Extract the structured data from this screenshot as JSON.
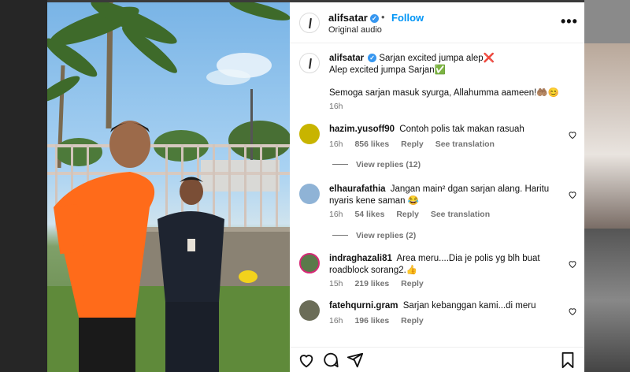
{
  "post": {
    "username": "alifsatar",
    "verified": true,
    "follow_label": "Follow",
    "audio_label": "Original audio",
    "more_label": "•••"
  },
  "caption": {
    "username": "alifsatar",
    "line1": "Sarjan excited jumpa alep❌",
    "line2": "Alep excited jumpa Sarjan✅",
    "line3": "Semoga sarjan masuk syurga, Allahumma aameen!🤲🏽😊",
    "time": "16h"
  },
  "comments": [
    {
      "username": "hazim.yusoff90",
      "text": "Contoh polis tak makan rasuah",
      "time": "16h",
      "likes": "856 likes",
      "reply": "Reply",
      "translate": "See translation",
      "view_replies": "View replies (12)",
      "avatar_color": "#c8b400"
    },
    {
      "username": "elhaurafathia",
      "text": "Jangan main² dgan sarjan alang. Haritu nyaris kene saman 😂",
      "time": "16h",
      "likes": "54 likes",
      "reply": "Reply",
      "translate": "See translation",
      "view_replies": "View replies (2)",
      "avatar_color": "#8fb3d6"
    },
    {
      "username": "indraghazali81",
      "text": "Area meru....Dia je polis yg blh buat roadblock sorang2.👍",
      "time": "15h",
      "likes": "219 likes",
      "reply": "Reply",
      "avatar_color": "#5a7a4a"
    },
    {
      "username": "fatehqurni.gram",
      "text": "Sarjan kebanggan kami...di meru",
      "time": "16h",
      "likes": "196 likes",
      "reply": "Reply",
      "avatar_color": "#6b6d58"
    }
  ],
  "actions": {
    "like_icon": "heart-icon",
    "comment_icon": "comment-icon",
    "share_icon": "share-icon",
    "save_icon": "bookmark-icon"
  },
  "colors": {
    "accent": "#0095f6",
    "verified": "#3797f0",
    "secondary_text": "#737373"
  }
}
